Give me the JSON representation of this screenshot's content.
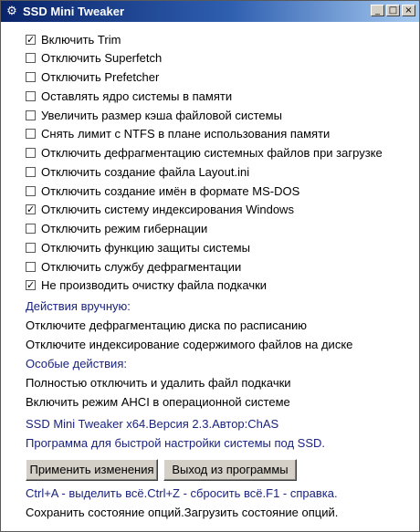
{
  "window": {
    "title": "SSD Mini Tweaker",
    "icon": "gear-icon",
    "controls": [
      "minimize-icon",
      "maximize-icon",
      "close-icon"
    ]
  },
  "options": [
    {
      "label": "Включить Trim",
      "checked": true
    },
    {
      "label": "Отключить Superfetch",
      "checked": false
    },
    {
      "label": "Отключить Prefetcher",
      "checked": false
    },
    {
      "label": "Оставлять ядро системы в памяти",
      "checked": false
    },
    {
      "label": "Увеличить размер кэша файловой системы",
      "checked": false
    },
    {
      "label": "Снять лимит с NTFS в плане использования памяти",
      "checked": false
    },
    {
      "label": "Отключить дефрагментацию системных файлов при загрузке",
      "checked": false
    },
    {
      "label": "Отключить создание файла Layout.ini",
      "checked": false
    },
    {
      "label": "Отключить создание имён в формате MS-DOS",
      "checked": false
    },
    {
      "label": "Отключить систему индексирования Windows",
      "checked": true
    },
    {
      "label": "Отключить режим гибернации",
      "checked": false
    },
    {
      "label": "Отключить функцию защиты системы",
      "checked": false
    },
    {
      "label": "Отключить службу дефрагментации",
      "checked": false
    },
    {
      "label": "Не производить очистку файла подкачки",
      "checked": true
    }
  ],
  "manual": {
    "heading": "Действия вручную:",
    "items": [
      "Отключите дефрагментацию диска по расписанию",
      "Отключите индексирование содержимого файлов на диске"
    ]
  },
  "special": {
    "heading": "Особые действия:",
    "items": [
      "Полностью отключить и удалить файл подкачки",
      "Включить режим AHCI в операционной системе"
    ]
  },
  "info": {
    "version": "SSD Mini Tweaker x64.Версия 2.3.Автор:ChAS",
    "description": "Программа для быстрой настройки системы под SSD."
  },
  "buttons": {
    "apply": "Применить изменения",
    "exit": "Выход из программы"
  },
  "footer": {
    "shortcuts": "Ctrl+A - выделить всё.Ctrl+Z - сбросить всё.F1 - справка.",
    "state": "Сохранить состояние опций.Загрузить состояние опций."
  },
  "colors": {
    "accent_text": "#1a237e",
    "titlebar_start": "#0a246a",
    "titlebar_end": "#a6caf0"
  }
}
